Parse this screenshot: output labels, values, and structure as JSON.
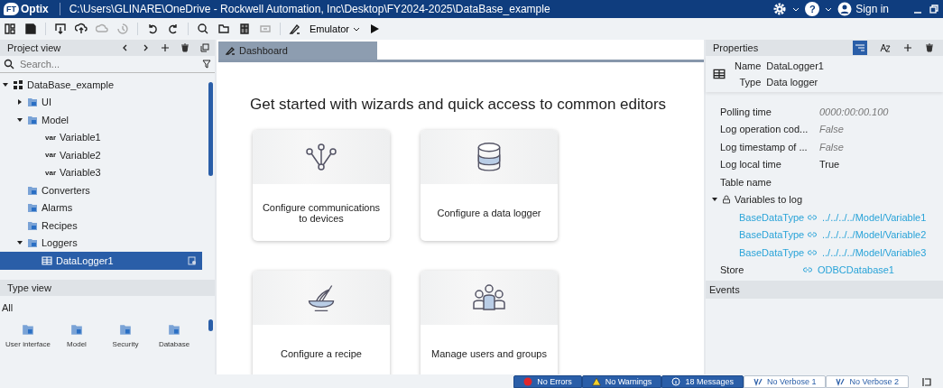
{
  "title_bar": {
    "logo_badge": "FT",
    "logo_name": "Optix",
    "path": "C:\\Users\\GLINARE\\OneDrive - Rockwell Automation, Inc\\Desktop\\FY2024-2025\\DataBase_example",
    "help": "?",
    "sign_in": "Sign in"
  },
  "toolbar": {
    "emulator": "Emulator"
  },
  "project_view": {
    "title": "Project view",
    "search": {
      "placeholder": "Search..."
    },
    "tree": [
      {
        "label": "DataBase_example",
        "kind": "project",
        "expanded": true,
        "selected": false,
        "children": [
          {
            "label": "UI",
            "kind": "folder",
            "expanded": false,
            "selected": false
          },
          {
            "label": "Model",
            "kind": "folder",
            "expanded": true,
            "selected": false,
            "children": [
              {
                "label": "Variable1",
                "prefix": "var",
                "selected": false
              },
              {
                "label": "Variable2",
                "prefix": "var",
                "selected": false
              },
              {
                "label": "Variable3",
                "prefix": "var",
                "selected": false
              }
            ]
          },
          {
            "label": "Converters",
            "kind": "folder",
            "selected": false
          },
          {
            "label": "Alarms",
            "kind": "folder",
            "selected": false
          },
          {
            "label": "Recipes",
            "kind": "folder",
            "selected": false
          },
          {
            "label": "Loggers",
            "kind": "folder",
            "expanded": true,
            "selected": false,
            "children": [
              {
                "label": "DataLogger1",
                "kind": "table",
                "selected": true
              }
            ]
          }
        ]
      }
    ]
  },
  "type_view": {
    "title": "Type view",
    "filter": "All",
    "items": [
      {
        "label": "User interface"
      },
      {
        "label": "Model"
      },
      {
        "label": "Security"
      },
      {
        "label": "Database"
      }
    ]
  },
  "editor": {
    "tabs": [
      {
        "label": "Dashboard",
        "selected": true
      }
    ],
    "heading": "Get started with wizards and quick access to common editors",
    "cards": [
      {
        "label": "Configure communications to devices",
        "kind": "network"
      },
      {
        "label": "Configure a data logger",
        "kind": "database"
      },
      {
        "label": "Configure a recipe",
        "kind": "whisk"
      },
      {
        "label": "Manage users and groups",
        "kind": "users"
      }
    ]
  },
  "properties": {
    "title": "Properties",
    "name_label": "Name",
    "name": "DataLogger1",
    "type_label": "Type",
    "type": "Data logger",
    "rows": [
      {
        "kind": "plain",
        "key": "Polling time",
        "value": "0000:00:00.100",
        "default": true
      },
      {
        "kind": "plain",
        "key": "Log operation cod...",
        "value": "False",
        "default": true
      },
      {
        "kind": "plain",
        "key": "Log timestamp of ...",
        "value": "False",
        "default": true
      },
      {
        "kind": "plain",
        "key": "Log local time",
        "value": "True",
        "default": false
      },
      {
        "kind": "plain",
        "key": "Table name"
      },
      {
        "kind": "group",
        "key": "Variables to log",
        "expanded": true
      },
      {
        "kind": "link",
        "key": "BaseDataType",
        "value": "../../../../Model/Variable1"
      },
      {
        "kind": "link",
        "key": "BaseDataType",
        "value": "../../../../Model/Variable2"
      },
      {
        "kind": "link",
        "key": "BaseDataType",
        "value": "../../../../Model/Variable3"
      },
      {
        "kind": "store",
        "key": "Store",
        "value": "ODBCDatabase1"
      }
    ],
    "events": "Events"
  },
  "status_bar": [
    {
      "label": "No Errors",
      "kind": "error",
      "selected": true
    },
    {
      "label": "No Warnings",
      "kind": "warning",
      "selected": true
    },
    {
      "label": "18 Messages",
      "kind": "info",
      "selected": true
    },
    {
      "label": "No Verbose 1",
      "kind": "verbose",
      "selected": false
    },
    {
      "label": "No Verbose 2",
      "kind": "verbose",
      "selected": false
    }
  ]
}
